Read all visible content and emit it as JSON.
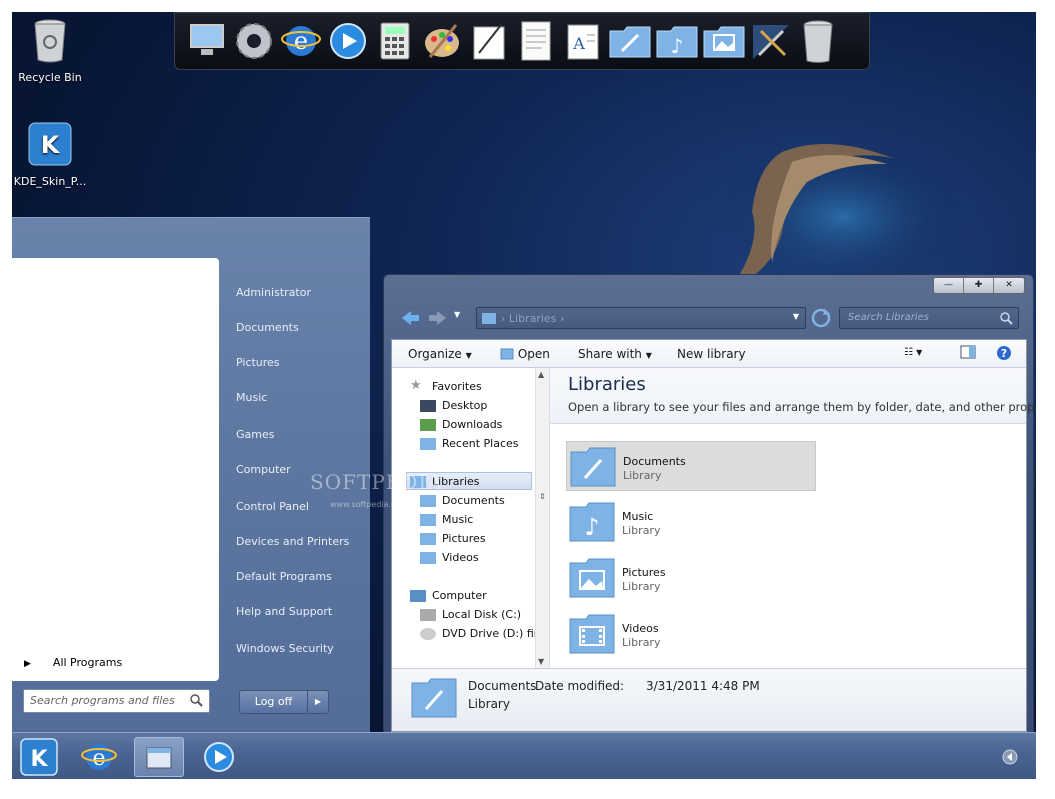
{
  "desktop": {
    "icons": [
      {
        "label": "Recycle Bin",
        "icon": "recycle-bin-icon"
      },
      {
        "label": "KDE_Skin_P...",
        "icon": "kde-logo-icon"
      }
    ]
  },
  "dock": {
    "items": [
      "computer-icon",
      "settings-gear-icon",
      "internet-explorer-icon",
      "media-player-icon",
      "calculator-icon",
      "paint-palette-icon",
      "notepad-icon",
      "text-document-icon",
      "wordpad-icon",
      "documents-folder-icon",
      "music-folder-icon",
      "pictures-folder-icon",
      "control-panel-tools-icon",
      "recycle-bin-icon"
    ]
  },
  "start_menu": {
    "all_programs": "All Programs",
    "search_placeholder": "Search programs and files",
    "links": [
      "Administrator",
      "Documents",
      "Pictures",
      "Music",
      "Games",
      "Computer",
      "Control Panel",
      "Devices and Printers",
      "Default Programs",
      "Help and Support",
      "Windows Security"
    ],
    "log_off": "Log off"
  },
  "explorer": {
    "address": "Libraries",
    "search_placeholder": "Search Libraries",
    "toolbar": {
      "organize": "Organize",
      "open": "Open",
      "share_with": "Share with",
      "new_library": "New library"
    },
    "nav": {
      "favorites": "Favorites",
      "favorites_items": [
        "Desktop",
        "Downloads",
        "Recent Places"
      ],
      "libraries": "Libraries",
      "libraries_items": [
        "Documents",
        "Music",
        "Pictures",
        "Videos"
      ],
      "computer": "Computer",
      "computer_items": [
        "Local Disk (C:)",
        "DVD Drive (D:) fine"
      ]
    },
    "header": {
      "title": "Libraries",
      "subtitle": "Open a library to see your files and arrange them by folder, date, and other prop..."
    },
    "libraries": [
      {
        "name": "Documents",
        "kind": "Library",
        "icon": "documents-folder-icon"
      },
      {
        "name": "Music",
        "kind": "Library",
        "icon": "music-folder-icon"
      },
      {
        "name": "Pictures",
        "kind": "Library",
        "icon": "pictures-folder-icon"
      },
      {
        "name": "Videos",
        "kind": "Library",
        "icon": "videos-folder-icon"
      }
    ],
    "details": {
      "name": "Documents",
      "modified_label": "Date modified:",
      "modified_value": "3/31/2011 4:48 PM",
      "kind": "Library"
    }
  },
  "watermark": {
    "text": "SOFTPEDIA",
    "url": "www.softpedia.com"
  },
  "taskbar": {
    "items": [
      "kde-start-icon",
      "internet-explorer-icon",
      "file-manager-icon",
      "media-player-icon"
    ]
  }
}
